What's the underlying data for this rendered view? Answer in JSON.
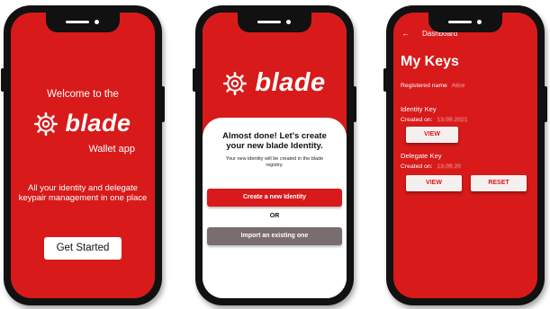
{
  "screens": {
    "welcome": {
      "welcome_text": "Welcome to the",
      "brand": "blade",
      "subtitle": "Wallet app",
      "tagline": "All your identity and delegate keypair management in one place",
      "get_started_label": "Get Started"
    },
    "identity": {
      "brand": "blade",
      "title": "Almost done! Let's create your new blade Identity.",
      "description": "Your new identity will be created in the blade registry.",
      "create_label": "Create a new Identity",
      "or_label": "OR",
      "import_label": "Import an existing one"
    },
    "dashboard": {
      "header_title": "Dashboard",
      "page_title": "My Keys",
      "registered_label": "Registered name",
      "registered_value": "Alice",
      "identity_key_label": "Identity Key",
      "identity_created_label": "Created on:",
      "identity_created_value": "13.09.2021",
      "view_label": "VIEW",
      "delegate_key_label": "Delegate Key",
      "delegate_created_label": "Created on:",
      "delegate_created_value": "13.09.20",
      "view2_label": "VIEW",
      "reset_label": "RESET"
    }
  },
  "colors": {
    "brand_red": "#d81a1a",
    "import_gray": "#7a6d6d",
    "phone_frame": "#111111"
  },
  "icons": [
    "gear-logo-icon",
    "back-arrow-icon"
  ]
}
